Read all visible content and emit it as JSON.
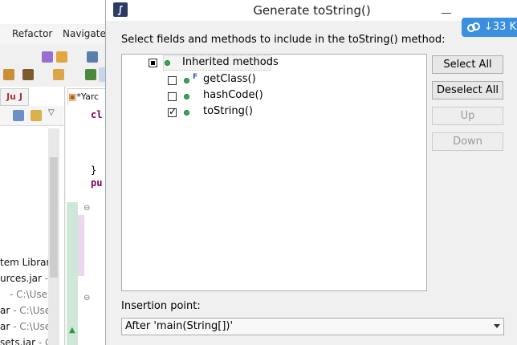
{
  "ide": {
    "menu": [
      "Refactor",
      "Navigate"
    ],
    "package_tab_label": "Ju J",
    "editor_tab_label": "*Yarc",
    "code_lines": [
      "cl",
      "}",
      "pu"
    ],
    "tree_lines": [
      {
        "name": "tem Librar",
        "path": ""
      },
      {
        "name": "urces.jar",
        "path": " - "
      },
      {
        "name": "",
        "path": " - C:\\Users"
      },
      {
        "name": "ar",
        "path": " - C:\\Use"
      },
      {
        "name": "ar",
        "path": " - C:\\Use"
      },
      {
        "name": "sets.jar",
        "path": " - C"
      }
    ]
  },
  "dialog": {
    "title": "Generate toString()",
    "prompt": "Select fields and methods to include in the toString() method:",
    "badge": "33 K",
    "tree": {
      "root": {
        "label": "Inherited methods",
        "state": "partial"
      },
      "children": [
        {
          "label": "getClass()",
          "checked": false,
          "final": true
        },
        {
          "label": "hashCode()",
          "checked": false,
          "final": false
        },
        {
          "label": "toString()",
          "checked": true,
          "final": false
        }
      ],
      "final_marker": "F"
    },
    "buttons": {
      "select_all": "Select All",
      "deselect_all": "Deselect All",
      "up": "Up",
      "down": "Down"
    },
    "insertion": {
      "label": "Insertion point:",
      "value": "After 'main(String[])'"
    }
  },
  "colors": {
    "accent": "#3b8fe0",
    "method_dot": "#3aa655"
  }
}
